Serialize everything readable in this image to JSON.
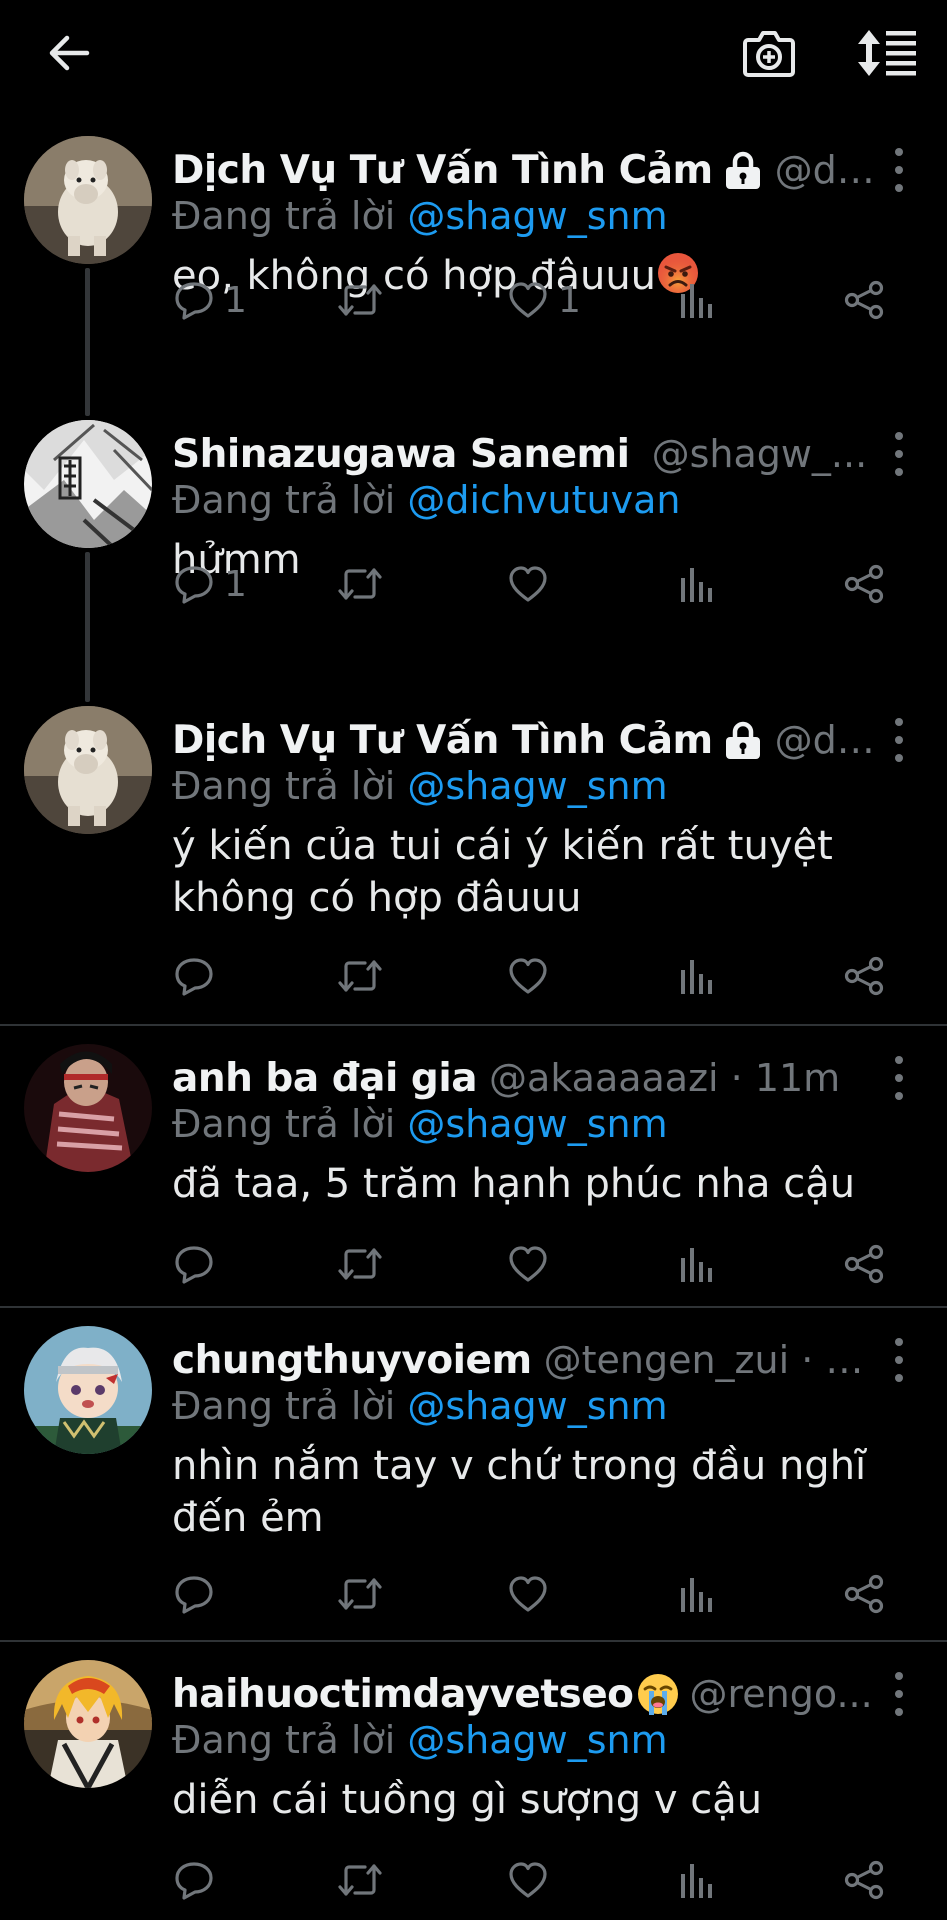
{
  "topbar": {
    "back_icon": "arrow-left-icon",
    "camera_icon": "camera-plus-icon",
    "sort_icon": "sort-list-icon"
  },
  "colors": {
    "background": "#000000",
    "text": "#e7e9ea",
    "muted": "#71767b",
    "mention": "#1d9bf0",
    "separator": "#2f3336"
  },
  "tweets": [
    {
      "name": "Dịch Vụ Tư Vấn Tình Cảm",
      "handle": "@di...",
      "protected": true,
      "replying_prefix": "Đang trả lời",
      "replying_to": "@shagw_snm",
      "text": "eo, không có hợp đâuuu",
      "text_emoji": "angry-face-emoji",
      "reply_count": "1",
      "retweet_count": "",
      "like_count": "1"
    },
    {
      "name": "Shinazugawa Sanemi",
      "handle": "@shagw_...",
      "replying_prefix": "Đang trả lời",
      "replying_to": "@dichvutuvan",
      "text": "hửmm",
      "reply_count": "1",
      "retweet_count": "",
      "like_count": ""
    },
    {
      "name": "Dịch Vụ Tư Vấn Tình Cảm",
      "handle": "@di...",
      "protected": true,
      "replying_prefix": "Đang trả lời",
      "replying_to": "@shagw_snm",
      "text": "ý kiến của tui cái ý kiến rất tuyệt không có hợp đâuuu",
      "reply_count": "",
      "retweet_count": "",
      "like_count": ""
    },
    {
      "name": "anh ba đại gia",
      "handle": "@akaaaaazi · 11m",
      "replying_prefix": "Đang trả lời",
      "replying_to": "@shagw_snm",
      "text": "đã taa, 5 trăm hạnh phúc nha cậu",
      "reply_count": "",
      "retweet_count": "",
      "like_count": ""
    },
    {
      "name": "chungthuyvoiem",
      "handle": "@tengen_zui · 9...",
      "replying_prefix": "Đang trả lời",
      "replying_to": "@shagw_snm",
      "text": "nhìn nắm tay v chứ trong đầu nghĩ đến ẻm",
      "reply_count": "",
      "retweet_count": "",
      "like_count": ""
    },
    {
      "name": "haihuoctimdayvetseo",
      "name_emoji": "loudly-crying-face-emoji",
      "handle": "@rengo...",
      "replying_prefix": "Đang trả lời",
      "replying_to": "@shagw_snm",
      "text": "diễn cái tuồng gì sượng v cậu",
      "reply_count": "",
      "retweet_count": "",
      "like_count": ""
    }
  ]
}
